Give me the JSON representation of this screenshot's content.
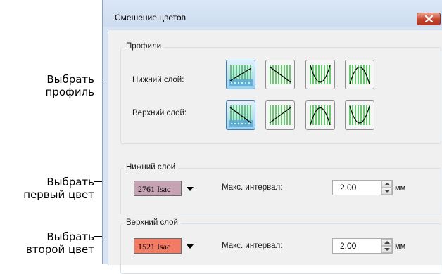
{
  "callouts": {
    "select_profile": [
      "Выбрать",
      "профиль"
    ],
    "select_first_color": [
      "Выбрать",
      "первый цвет"
    ],
    "select_second_color": [
      "Выбрать",
      "второй цвет"
    ]
  },
  "window": {
    "title": "Смешение цветов",
    "close_icon": "close-icon"
  },
  "profiles": {
    "group_title": "Профили",
    "bottom_layer_label": "Нижний слой:",
    "top_layer_label": "Верхний слой:",
    "bottom_layer_buttons": [
      "ramp-up",
      "ramp-down",
      "u-curve",
      "arch-curve"
    ],
    "bottom_layer_selected": "ramp-up",
    "top_layer_buttons": [
      "ramp-down",
      "ramp-up",
      "arch-curve",
      "u-curve"
    ],
    "top_layer_selected": "ramp-down"
  },
  "bottom_layer": {
    "group_title": "Нижний слой",
    "color_code": "2761 Isac",
    "color_hex": "#c6a3b3",
    "max_interval_label": "Макс. интервал:",
    "max_interval_value": "2.00",
    "unit": "мм"
  },
  "top_layer": {
    "group_title": "Верхний слой",
    "color_code": "1521 Isac",
    "color_hex": "#f37b63",
    "max_interval_label": "Макс. интервал:",
    "max_interval_value": "2.00",
    "unit": "мм"
  },
  "colors": {
    "accent_line": "#2db83a",
    "selected_button": "#bfe0f5"
  }
}
